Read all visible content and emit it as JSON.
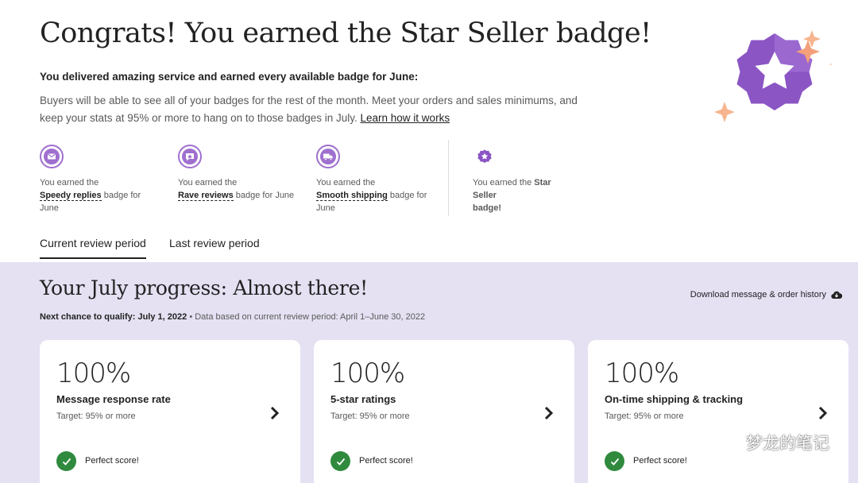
{
  "header": {
    "title": "Congrats! You earned the Star Seller badge!",
    "subheading": "You delivered amazing service and earned every available badge for June:",
    "description": "Buyers will be able to see all of your badges for the rest of the month. Meet your orders and sales minimums, and keep your stats at 95% or more to hang on to those badges in July.",
    "learn_link": "Learn how it works"
  },
  "badges": [
    {
      "icon": "envelope-icon",
      "prefix": "You earned the",
      "name": "Speedy replies",
      "suffix": "badge for June"
    },
    {
      "icon": "star-review-icon",
      "prefix": "You earned the",
      "name": "Rave reviews",
      "suffix": "badge for June"
    },
    {
      "icon": "truck-icon",
      "prefix": "You earned the",
      "name": "Smooth shipping",
      "suffix": "badge for June"
    },
    {
      "icon": "star-badge-icon",
      "prefix": "You earned the",
      "name": "Star Seller",
      "suffix": "badge!"
    }
  ],
  "tabs": [
    {
      "label": "Current review period",
      "active": true
    },
    {
      "label": "Last review period",
      "active": false
    }
  ],
  "progress": {
    "title": "Your July progress: Almost there!",
    "next_chance": "Next chance to qualify: July 1, 2022",
    "separator": "•",
    "data_based": "Data based on current review period: April 1–June 30, 2022",
    "download_label": "Download message & order history"
  },
  "cards": [
    {
      "percent": "100%",
      "label": "Message response rate",
      "target": "Target: 95% or more",
      "status": "Perfect score!"
    },
    {
      "percent": "100%",
      "label": "5-star ratings",
      "target": "Target: 95% or more",
      "status": "Perfect score!"
    },
    {
      "percent": "100%",
      "label": "On-time shipping & tracking",
      "target": "Target: 95% or more",
      "status": "Perfect score!"
    }
  ],
  "watermark": {
    "text": "梦龙的笔记"
  },
  "colors": {
    "accent_purple": "#9f6fcf",
    "badge_purple": "#8b55c4",
    "progress_bg": "#e5e1f3",
    "success_green": "#2f8a3e",
    "sparkle_orange": "#f3a07a"
  }
}
